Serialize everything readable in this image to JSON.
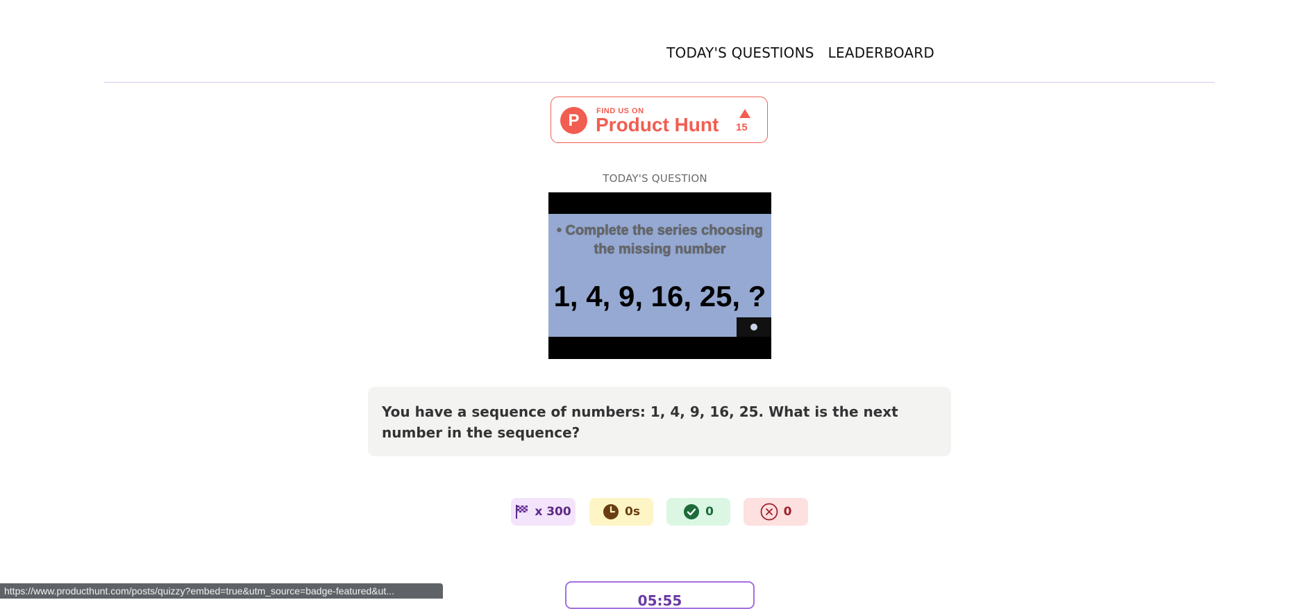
{
  "nav": {
    "items": [
      "TODAY'S QUESTIONS",
      "LEADERBOARD"
    ]
  },
  "badge": {
    "small_text": "FIND US ON",
    "big_text": "Product Hunt",
    "logo_letter": "P",
    "upvotes": "15",
    "color": "#f25d51"
  },
  "question": {
    "label": "TODAY'S QUESTION",
    "image_line1": "• Complete the series choosing",
    "image_line2": "the missing number",
    "image_series": "1, 4, 9, 16, 25, ?",
    "text": "You have a sequence of numbers: 1, 4, 9, 16, 25. What is the next number in the sequence?"
  },
  "stats": {
    "multiplier": "x 300",
    "time": "0s",
    "correct": "0",
    "wrong": "0"
  },
  "timer": {
    "value": "05:55"
  },
  "status_bar": {
    "url": "https://www.producthunt.com/posts/quizzy?embed=true&utm_source=badge-featured&ut..."
  },
  "icons": {
    "flag": "checkered-flag-icon",
    "clock": "clock-icon",
    "check": "check-circle-icon",
    "x": "x-circle-icon",
    "upvote": "upvote-triangle-icon"
  }
}
